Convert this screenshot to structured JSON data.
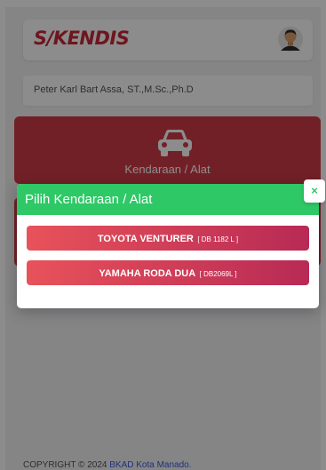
{
  "header": {
    "logo_text": "S/KENDIS",
    "avatar_icon": "user-avatar-icon"
  },
  "user": {
    "name": "Peter Karl Bart Assa, ST.,M.Sc.,Ph.D"
  },
  "vehicle_card": {
    "icon": "car-icon",
    "label": "Kendaraan / Alat"
  },
  "footer": {
    "copyright": "COPYRIGHT © 2024",
    "link": "BKAD Kota Manado."
  },
  "modal": {
    "title": "Pilih Kendaraan / Alat",
    "close_label": "×",
    "options": [
      {
        "name": "TOYOTA VENTURER",
        "plate": "[ DB 1182 L ]"
      },
      {
        "name": "YAMAHA RODA DUA",
        "plate": "[ DB2069L ]"
      }
    ]
  },
  "colors": {
    "brand_red": "#c62838",
    "card_red": "#d03b48",
    "modal_green": "#2ec866",
    "button_gradient_start": "#e8525a",
    "button_gradient_end": "#b82a55"
  }
}
